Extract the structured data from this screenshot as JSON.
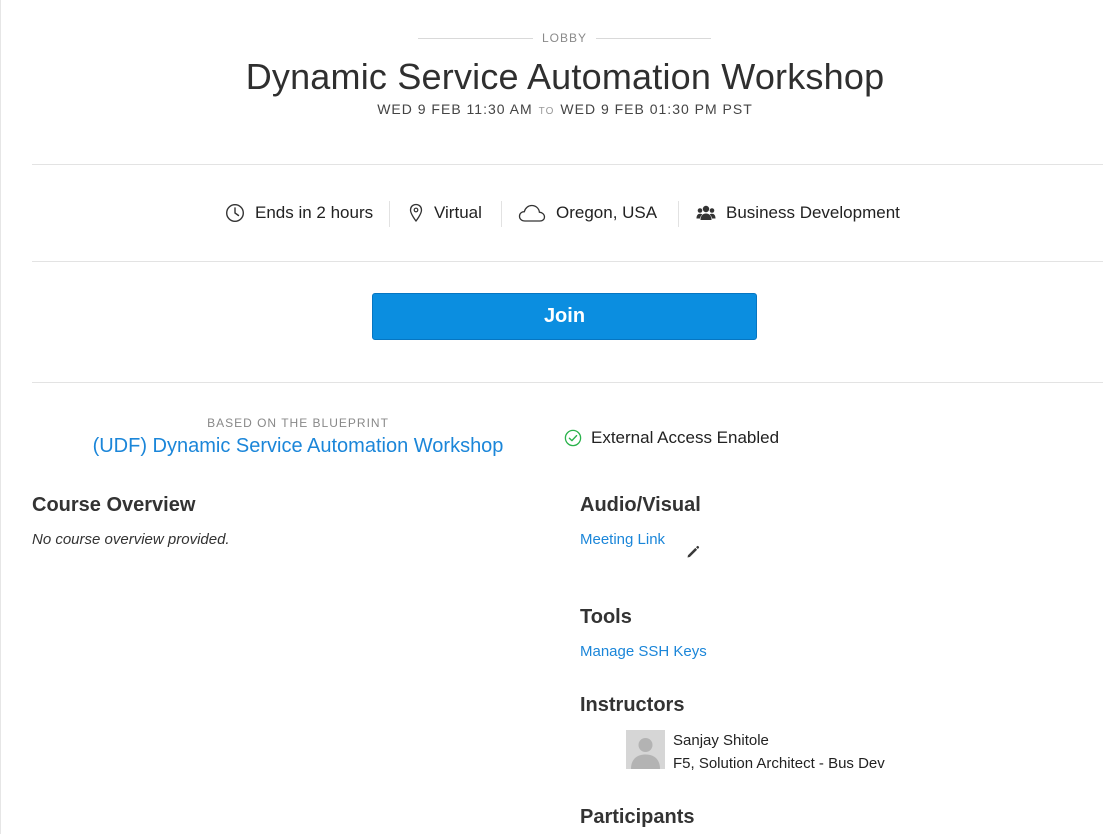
{
  "header": {
    "section_label": "LOBBY",
    "title": "Dynamic Service Automation Workshop",
    "start": "WED 9 FEB 11:30 AM",
    "to_label": "TO",
    "end": "WED 9 FEB 01:30 PM PST"
  },
  "info": {
    "time_remaining": "Ends in 2 hours",
    "location_type": "Virtual",
    "region": "Oregon, USA",
    "department": "Business Development"
  },
  "join": {
    "label": "Join"
  },
  "blueprint": {
    "label": "BASED ON THE BLUEPRINT",
    "name": "(UDF) Dynamic Service Automation Workshop"
  },
  "access": {
    "status": "External Access Enabled"
  },
  "course_overview": {
    "title": "Course Overview",
    "text": "No course overview provided."
  },
  "audio_visual": {
    "title": "Audio/Visual",
    "link": "Meeting Link"
  },
  "tools": {
    "title": "Tools",
    "link": "Manage SSH Keys"
  },
  "instructors": {
    "title": "Instructors",
    "items": [
      {
        "name": "Sanjay Shitole",
        "role": "F5, Solution Architect - Bus Dev"
      }
    ]
  },
  "participants": {
    "title": "Participants"
  },
  "icons": {
    "clock": "clock-icon",
    "location": "map-pin-icon",
    "cloud": "cloud-icon",
    "users": "users-icon",
    "check": "check-circle-icon",
    "edit": "pencil-icon"
  },
  "colors": {
    "primary": "#0b8ee0",
    "link": "#1b86d9",
    "success": "#2ab24b"
  }
}
